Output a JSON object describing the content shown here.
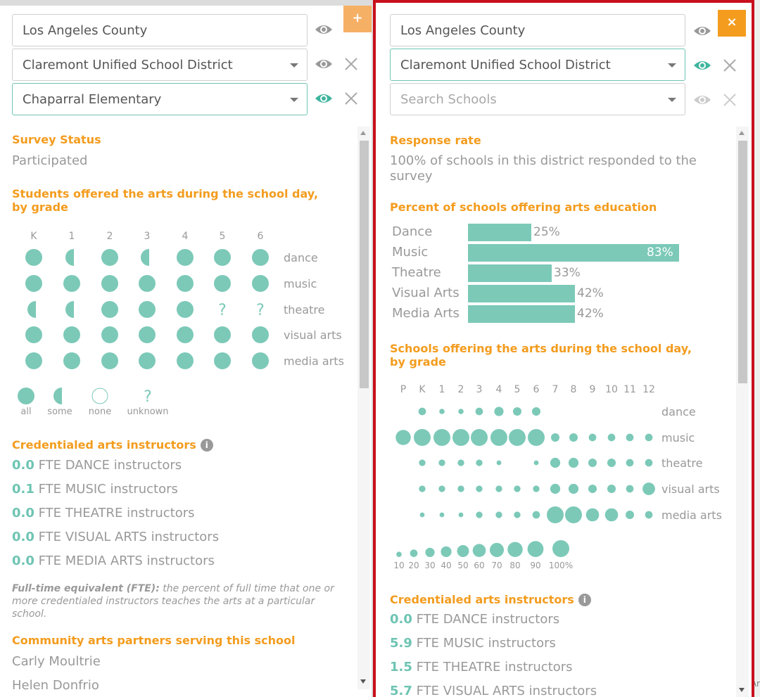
{
  "colors": {
    "accent": "#f39c1e",
    "teal": "#7cc9b8",
    "frame": "#c8101c"
  },
  "left": {
    "county": "Los Angeles County",
    "district": "Claremont Unified School District",
    "school": "Chaparral Elementary",
    "add_glyph": "+",
    "survey_status_heading": "Survey Status",
    "survey_status_value": "Participated",
    "grades_heading_1": "Students offered the arts during the school day,",
    "grades_heading_2": "by grade",
    "grades": [
      "K",
      "1",
      "2",
      "3",
      "4",
      "5",
      "6"
    ],
    "disciplines": [
      "dance",
      "music",
      "theatre",
      "visual arts",
      "media arts"
    ],
    "matrix": [
      [
        "all",
        "some",
        "all",
        "some",
        "all",
        "all",
        "all"
      ],
      [
        "all",
        "all",
        "all",
        "all",
        "all",
        "all",
        "all"
      ],
      [
        "some",
        "some",
        "all",
        "all",
        "all",
        "unknown",
        "unknown"
      ],
      [
        "all",
        "all",
        "all",
        "all",
        "all",
        "all",
        "all"
      ],
      [
        "all",
        "all",
        "all",
        "all",
        "all",
        "all",
        "all"
      ]
    ],
    "legend": [
      "all",
      "some",
      "none",
      "unknown"
    ],
    "instructors_heading": "Credentialed arts instructors",
    "fte": [
      {
        "value": "0.0",
        "label": "FTE DANCE instructors"
      },
      {
        "value": "0.1",
        "label": "FTE MUSIC instructors"
      },
      {
        "value": "0.0",
        "label": "FTE THEATRE instructors"
      },
      {
        "value": "0.0",
        "label": "FTE VISUAL ARTS instructors"
      },
      {
        "value": "0.0",
        "label": "FTE MEDIA ARTS instructors"
      }
    ],
    "fte_note_bold": "Full-time equivalent (FTE):",
    "fte_note_rest": " the percent of full time that one or more credentialed instructors teaches the arts at a particular school.",
    "partners_heading": "Community arts partners serving this school",
    "partners": [
      "Carly Moultrie",
      "Helen Donfrio"
    ]
  },
  "right": {
    "county": "Los Angeles County",
    "district": "Claremont Unified School District",
    "school_placeholder": "Search Schools",
    "close_glyph": "×",
    "response_heading": "Response rate",
    "response_text": "100% of schools in this district responded to the survey",
    "percent_heading": "Percent of schools offering arts education",
    "bars": [
      {
        "label": "Dance",
        "pct": 25,
        "text": "25%"
      },
      {
        "label": "Music",
        "pct": 83,
        "text": "83%"
      },
      {
        "label": "Theatre",
        "pct": 33,
        "text": "33%"
      },
      {
        "label": "Visual Arts",
        "pct": 42,
        "text": "42%"
      },
      {
        "label": "Media Arts",
        "pct": 42,
        "text": "42%"
      }
    ],
    "grades_heading_1": "Schools offering the arts during the school day,",
    "grades_heading_2": "by grade",
    "grades": [
      "P",
      "K",
      "1",
      "2",
      "3",
      "4",
      "5",
      "6",
      "7",
      "8",
      "9",
      "10",
      "11",
      "12"
    ],
    "disciplines": [
      "dance",
      "music",
      "theatre",
      "visual arts",
      "media arts"
    ],
    "bubble_pct": [
      [
        0,
        20,
        10,
        10,
        20,
        30,
        25,
        25,
        0,
        0,
        0,
        0,
        0,
        0
      ],
      [
        80,
        100,
        100,
        100,
        100,
        100,
        100,
        100,
        25,
        25,
        20,
        20,
        20,
        20
      ],
      [
        0,
        15,
        15,
        15,
        15,
        8,
        0,
        8,
        35,
        35,
        25,
        25,
        20,
        20
      ],
      [
        0,
        15,
        15,
        15,
        15,
        15,
        15,
        15,
        35,
        35,
        25,
        25,
        20,
        55
      ],
      [
        0,
        8,
        8,
        8,
        15,
        15,
        15,
        20,
        100,
        100,
        60,
        60,
        25,
        20
      ]
    ],
    "size_legend": [
      "10",
      "20",
      "30",
      "40",
      "50",
      "60",
      "70",
      "80",
      "90",
      "100%"
    ],
    "instructors_heading": "Credentialed arts instructors",
    "fte": [
      {
        "value": "0.0",
        "label": "FTE DANCE instructors"
      },
      {
        "value": "5.9",
        "label": "FTE MUSIC instructors"
      },
      {
        "value": "1.5",
        "label": "FTE THEATRE instructors"
      },
      {
        "value": "5.7",
        "label": "FTE VISUAL ARTS instructors"
      }
    ]
  },
  "map_attribution": "Ar"
}
